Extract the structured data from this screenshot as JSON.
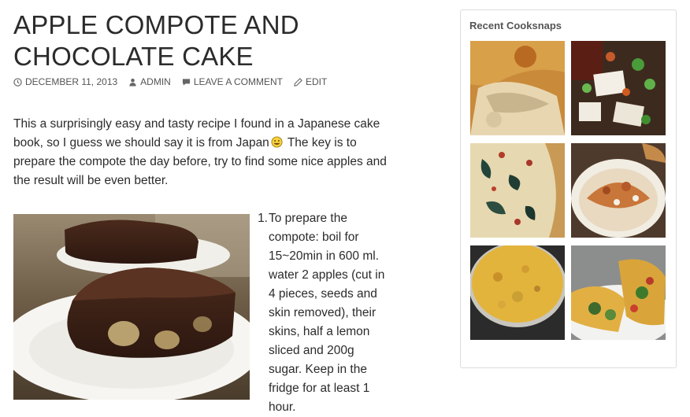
{
  "post": {
    "title": "APPLE COMPOTE AND CHOCOLATE CAKE",
    "meta": {
      "date": "DECEMBER 11, 2013",
      "author": "ADMIN",
      "comment": "LEAVE A COMMENT",
      "edit": "EDIT"
    },
    "intro_before_emoji": "This a surprisingly easy and tasty recipe I found in a Japanese cake book, so I guess we should say it is from Japan",
    "intro_after_emoji": " The key is to prepare the compote the day before, try to find some nice apples and the result will be even better.",
    "steps": [
      {
        "number": "1.",
        "text": "To prepare the compote: boil for 15~20min in 600 ml. water 2 apples (cut in 4 pieces, seeds and skin removed), their skins, half a lemon sliced and 200g sugar. Keep in the fridge for at least 1 hour."
      }
    ]
  },
  "sidebar": {
    "widget_title": "Recent Cooksnaps",
    "snaps": [
      {
        "icon": "apple-tart-photo"
      },
      {
        "icon": "tofu-salad-photo"
      },
      {
        "icon": "spinach-quiche-photo"
      },
      {
        "icon": "rice-bowl-photo"
      },
      {
        "icon": "spanish-omelette-photo"
      },
      {
        "icon": "tacos-photo"
      }
    ]
  },
  "colors": {
    "text": "#2b2b2b",
    "meta": "#555555",
    "border": "#dcdcdc"
  }
}
